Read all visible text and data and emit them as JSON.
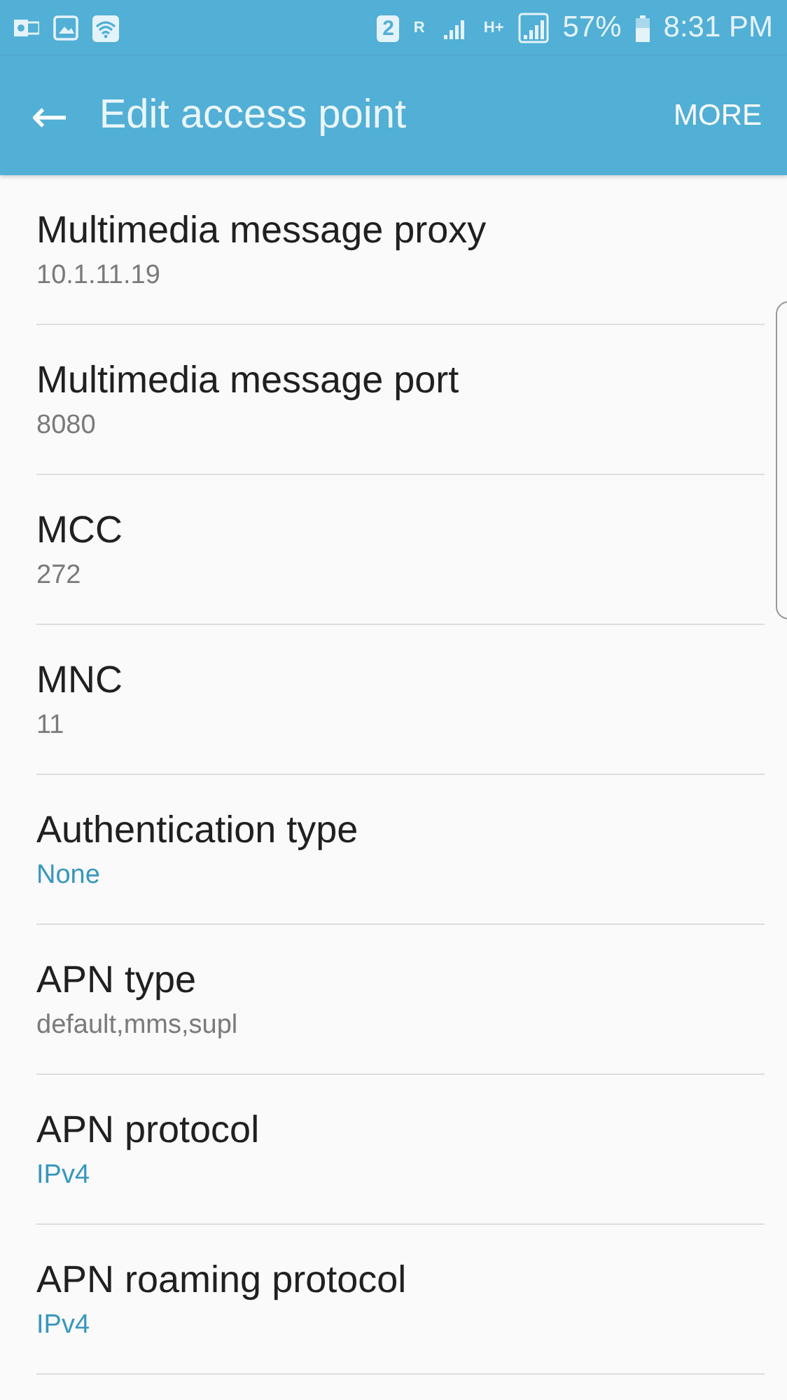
{
  "status_bar": {
    "sim_slot": "2",
    "roaming": "R",
    "network": "H+",
    "battery": "57%",
    "time": "8:31 PM"
  },
  "toolbar": {
    "back": "←",
    "title": "Edit access point",
    "more": "MORE"
  },
  "settings": [
    {
      "label": "Multimedia message proxy",
      "value": "10.1.11.19",
      "kind": "text"
    },
    {
      "label": "Multimedia message port",
      "value": "8080",
      "kind": "text"
    },
    {
      "label": "MCC",
      "value": "272",
      "kind": "text"
    },
    {
      "label": "MNC",
      "value": "11",
      "kind": "text"
    },
    {
      "label": "Authentication type",
      "value": "None",
      "kind": "choice"
    },
    {
      "label": "APN type",
      "value": "default,mms,supl",
      "kind": "text"
    },
    {
      "label": "APN protocol",
      "value": "IPv4",
      "kind": "choice"
    },
    {
      "label": "APN roaming protocol",
      "value": "IPv4",
      "kind": "choice"
    }
  ]
}
